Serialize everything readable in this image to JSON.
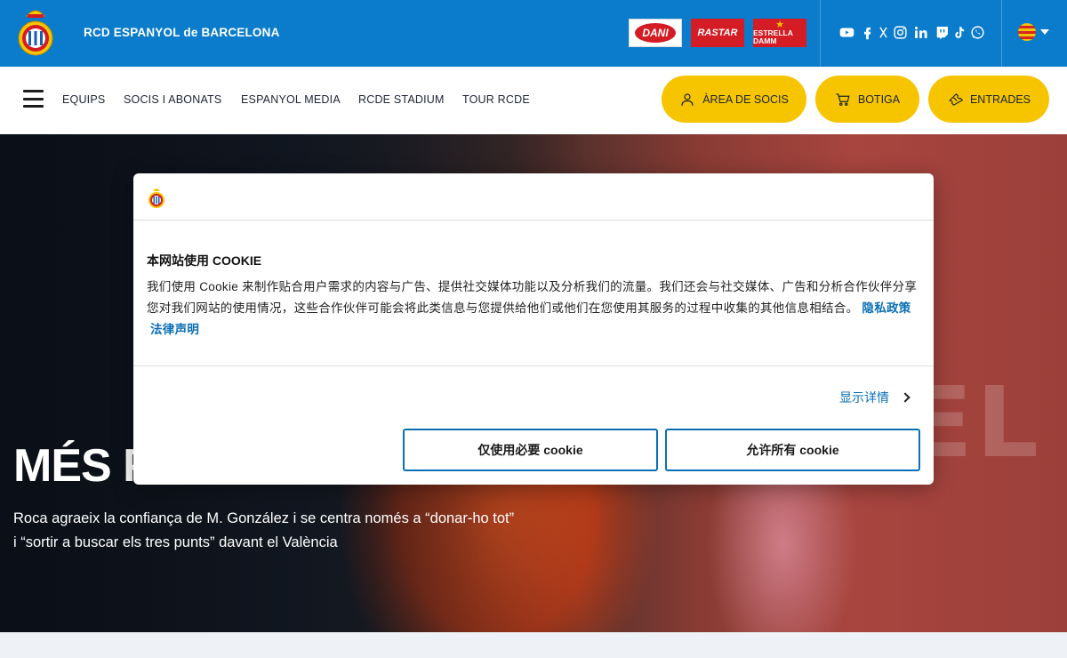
{
  "header": {
    "club_name": "RCD ESPANYOL de BARCELONA",
    "sponsors": [
      "DANI",
      "RASTAR",
      "ESTRELLA DAMM"
    ],
    "social_icons": [
      "youtube-icon",
      "facebook-icon",
      "x-icon",
      "instagram-icon",
      "linkedin-icon",
      "twitch-icon",
      "tiktok-icon",
      "whatsapp-icon"
    ],
    "language_flag": "catalan-flag",
    "colors": {
      "bar": "#0a7ccb",
      "accent": "#f6c500",
      "link": "#0a6fb5"
    }
  },
  "nav": {
    "items": [
      "EQUIPS",
      "SOCIS I ABONATS",
      "ESPANYOL MEDIA",
      "RCDE STADIUM",
      "TOUR RCDE"
    ],
    "buttons": {
      "members": "ÀREA DE SOCIS",
      "shop": "BOTIGA",
      "tickets": "ENTRADES"
    }
  },
  "hero": {
    "title": "MÉS PA",
    "subtitle": "Roca agraeix la confiança de M. González i se centra només a “donar-ho tot” i “sortir a buscar els tres punts” davant el València",
    "background_text": "REL"
  },
  "cookie_dialog": {
    "title": "本网站使用 COOKIE",
    "body": "我们使用 Cookie 来制作贴合用户需求的内容与广告、提供社交媒体功能以及分析我们的流量。我们还会与社交媒体、广告和分析合作伙伴分享您对我们网站的使用情况，这些合作伙伴可能会将此类信息与您提供给他们或他们在您使用其服务的过程中收集的其他信息相结合。",
    "privacy_link": "隐私政策",
    "legal_link": "法律声明",
    "show_details": "显示详情",
    "necessary_button": "仅使用必要 cookie",
    "allow_all_button": "允许所有 cookie"
  }
}
